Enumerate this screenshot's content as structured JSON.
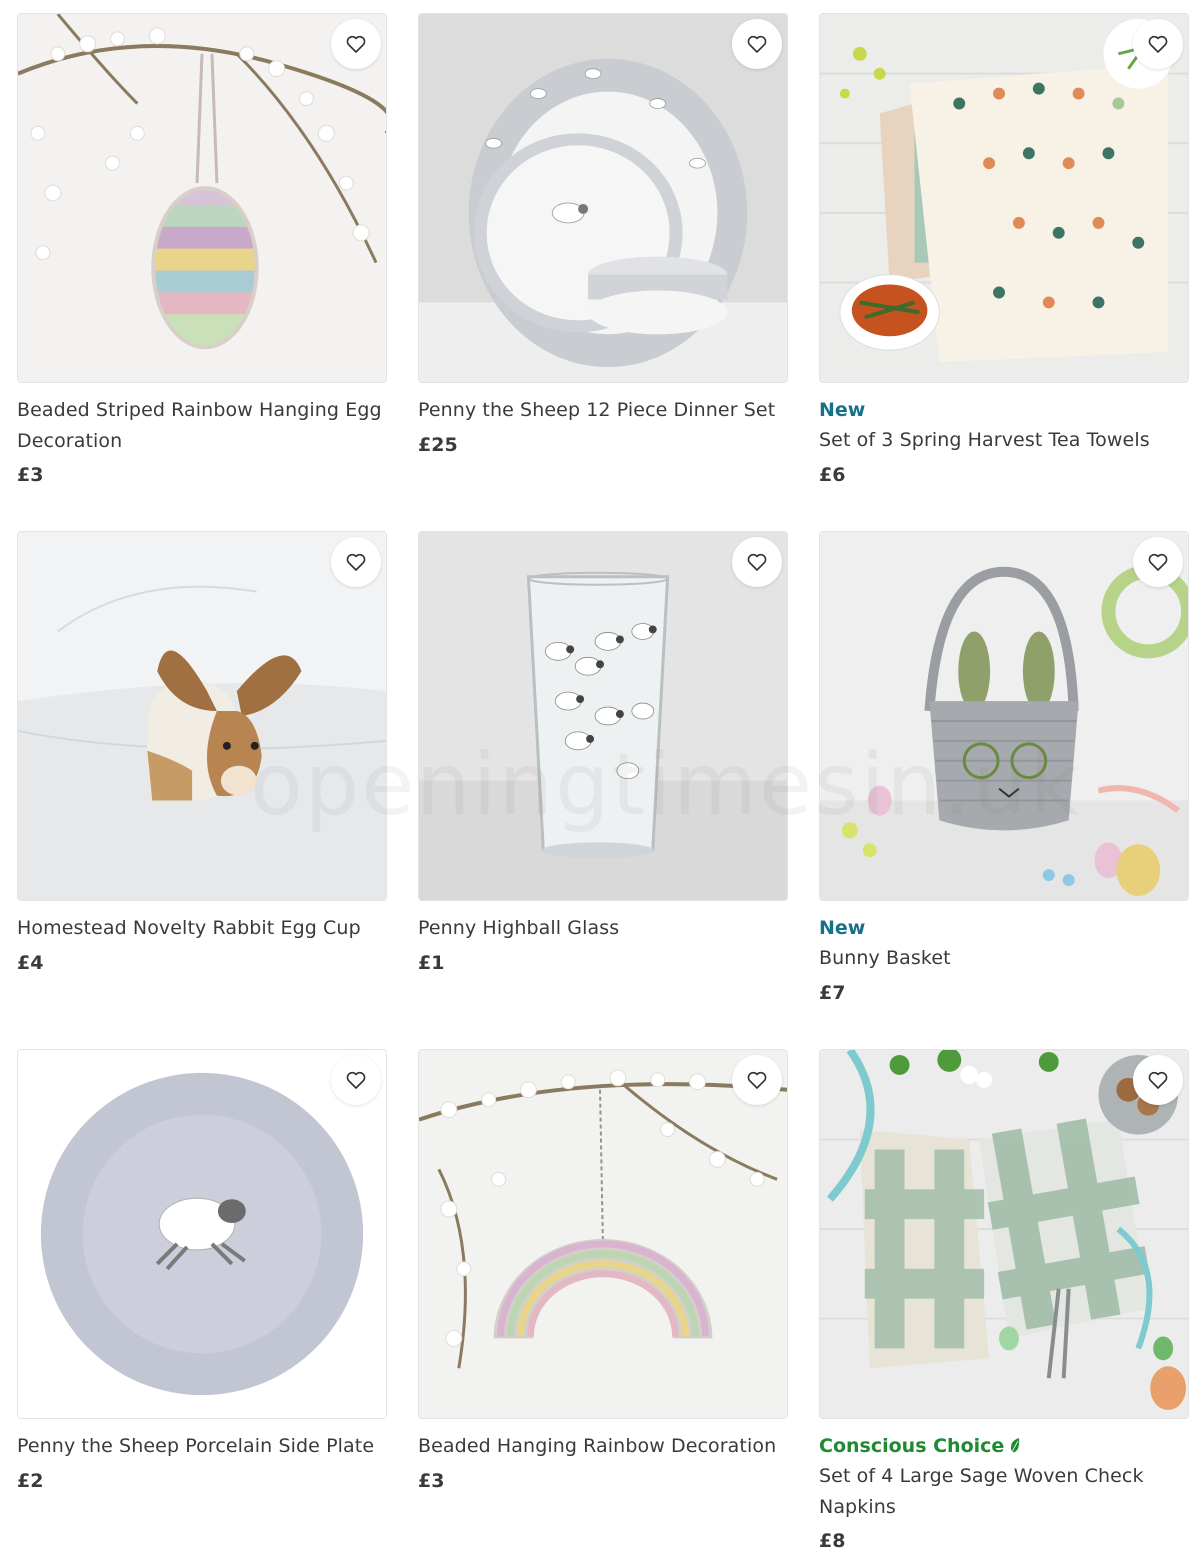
{
  "colors": {
    "new_badge": "#17708a",
    "conscious_badge": "#1e8a33",
    "text": "#3a3a3a"
  },
  "watermark": "openingtimesin.uk",
  "products": [
    {
      "badge": "",
      "title": "Beaded Striped Rainbow Hanging Egg Decoration",
      "price": "£3",
      "image": "beaded-egg-image"
    },
    {
      "badge": "",
      "title": "Penny the Sheep 12 Piece Dinner Set",
      "price": "£25",
      "image": "sheep-dinner-set-image"
    },
    {
      "badge": "New",
      "title": "Set of 3 Spring Harvest Tea Towels",
      "price": "£6",
      "image": "tea-towels-image"
    },
    {
      "badge": "",
      "title": "Homestead Novelty Rabbit Egg Cup",
      "price": "£4",
      "image": "rabbit-egg-cup-image"
    },
    {
      "badge": "",
      "title": "Penny Highball Glass",
      "price": "£1",
      "image": "highball-glass-image"
    },
    {
      "badge": "New",
      "title": "Bunny Basket",
      "price": "£7",
      "image": "bunny-basket-image"
    },
    {
      "badge": "",
      "title": "Penny the Sheep Porcelain Side Plate",
      "price": "£2",
      "image": "sheep-side-plate-image"
    },
    {
      "badge": "",
      "title": "Beaded Hanging Rainbow Decoration",
      "price": "£3",
      "image": "rainbow-decoration-image"
    },
    {
      "badge": "Conscious Choice",
      "title": "Set of 4 Large Sage Woven Check Napkins",
      "price": "£8",
      "image": "sage-napkins-image"
    }
  ],
  "icons": {
    "favourite": "heart-outline-icon",
    "conscious": "leaf-icon"
  }
}
